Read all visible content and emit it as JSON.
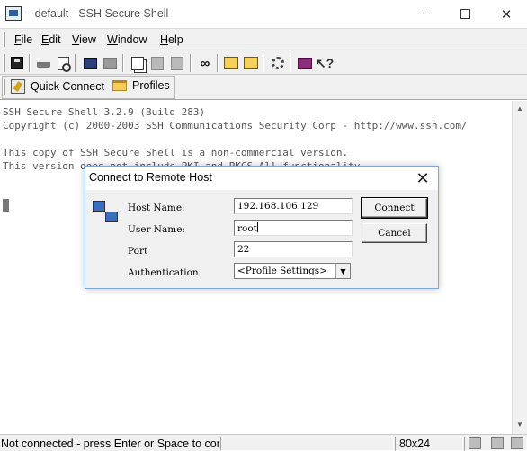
{
  "window": {
    "title": " - default - SSH Secure Shell",
    "app_icon": "ssh-secure-shell-icon",
    "controls": {
      "minimize": "minimize",
      "maximize": "maximize",
      "close": "✕"
    }
  },
  "menu": {
    "items": [
      {
        "mnemonic": "F",
        "rest": "ile"
      },
      {
        "mnemonic": "E",
        "rest": "dit"
      },
      {
        "mnemonic": "V",
        "rest": "iew"
      },
      {
        "mnemonic": "W",
        "rest": "indow"
      },
      {
        "mnemonic": "H",
        "rest": "elp"
      }
    ]
  },
  "toolbar": {
    "icons": [
      "save-icon",
      "print-icon",
      "print-preview-icon",
      "new-terminal-icon",
      "new-file-transfer-icon",
      "copy-icon",
      "paste-icon",
      "paste-disabled-icon",
      "find-icon",
      "settings-icon",
      "keys-icon",
      "profile-settings-icon",
      "help-topics-icon",
      "whats-this-icon"
    ]
  },
  "profiles_bar": {
    "quick_connect_label": "Quick Connect",
    "profiles_label": "Profiles"
  },
  "terminal": {
    "lines": [
      "SSH Secure Shell 3.2.9 (Build 283)",
      "Copyright (c) 2000-2003 SSH Communications Security Corp - http://www.ssh.com/",
      "",
      "This copy of SSH Secure Shell is a non-commercial version.",
      "This version does not include PKI and PKCS All functionality"
    ]
  },
  "statusbar": {
    "message": "Not connected - press Enter or Space to connect",
    "size": "80x24"
  },
  "dialog": {
    "title": "Connect to Remote Host",
    "close": "✕",
    "host_label": "Host Name:",
    "host_value": "192.168.106.129",
    "user_label": "User Name:",
    "user_value": "root",
    "port_label": "Port",
    "port_value": "22",
    "auth_label": "Authentication",
    "auth_value": "<Profile Settings>",
    "connect_button": "Connect",
    "cancel_button": "Cancel"
  },
  "colors": {
    "chrome": "#f0f0f0",
    "terminal_text": "#555555",
    "dialog_border": "#7fa6d6"
  }
}
